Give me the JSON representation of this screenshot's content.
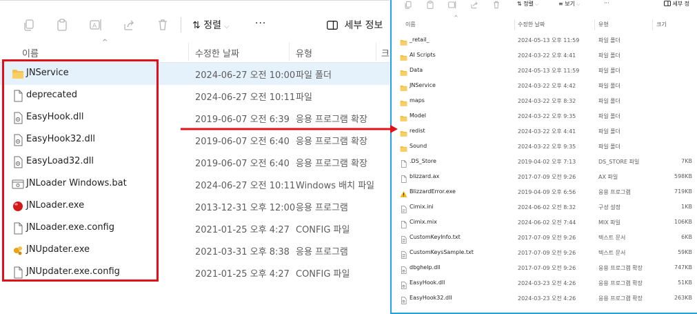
{
  "colors": {
    "highlight": "#e0101a",
    "accent": "#1fa2e8",
    "folder": "#f5c04a",
    "selection": "#e5f1fb"
  },
  "left": {
    "toolbar": {
      "icons": [
        "copy-icon",
        "paste-icon",
        "rename-icon",
        "share-icon",
        "delete-icon"
      ],
      "sort_label": "정렬",
      "more_label": "···",
      "details_label": "세부 정보"
    },
    "columns": {
      "name": "이름",
      "date": "수정한 날짜",
      "type": "유형",
      "size": "크"
    },
    "files": [
      {
        "name": "JNService",
        "date": "2024-06-27 오전 10:00",
        "type": "파일 폴더",
        "icon": "folder-icon"
      },
      {
        "name": "deprecated",
        "date": "2024-06-27 오전 10:11",
        "type": "파일",
        "icon": "file-icon"
      },
      {
        "name": "EasyHook.dll",
        "date": "2019-06-07 오전 6:39",
        "type": "응용 프로그램 확장",
        "icon": "dll-icon"
      },
      {
        "name": "EasyHook32.dll",
        "date": "2019-06-07 오전 6:40",
        "type": "응용 프로그램 확장",
        "icon": "dll-icon"
      },
      {
        "name": "EasyLoad32.dll",
        "date": "2019-06-07 오전 6:40",
        "type": "응용 프로그램 확장",
        "icon": "dll-icon"
      },
      {
        "name": "JNLoader Windows.bat",
        "date": "2024-06-27 오전 10:11",
        "type": "Windows 배치 파일",
        "icon": "bat-icon"
      },
      {
        "name": "JNLoader.exe",
        "date": "2013-12-31 오후 12:00",
        "type": "응용 프로그램",
        "icon": "red-ball-icon"
      },
      {
        "name": "JNLoader.exe.config",
        "date": "2021-01-25 오후 4:27",
        "type": "CONFIG 파일",
        "icon": "file-icon"
      },
      {
        "name": "JNUpdater.exe",
        "date": "2021-03-31 오후 8:38",
        "type": "응용 프로그램",
        "icon": "updater-icon"
      },
      {
        "name": "JNUpdater.exe.config",
        "date": "2021-01-25 오후 4:27",
        "type": "CONFIG 파일",
        "icon": "file-icon"
      }
    ]
  },
  "right": {
    "toolbar": {
      "icons": [
        "copy-icon",
        "paste-icon",
        "rename-icon",
        "share-icon",
        "delete-icon"
      ],
      "sort_label": "정렬",
      "view_label": "보기",
      "more_label": "···",
      "details_label": "세부 정"
    },
    "columns": {
      "name": "이름",
      "date": "수정한 날짜",
      "type": "유형",
      "size": "크기"
    },
    "files": [
      {
        "name": "_retail_",
        "date": "2024-05-13 오후 11:59",
        "type": "파일 폴더",
        "size": "",
        "icon": "folder-icon"
      },
      {
        "name": "AI Scripts",
        "date": "2024-03-22 오후 4:41",
        "type": "파일 폴더",
        "size": "",
        "icon": "folder-icon"
      },
      {
        "name": "Data",
        "date": "2024-05-13 오후 11:59",
        "type": "파일 폴더",
        "size": "",
        "icon": "folder-icon"
      },
      {
        "name": "JNService",
        "date": "2024-03-22 오후 4:42",
        "type": "파일 폴더",
        "size": "",
        "icon": "folder-icon"
      },
      {
        "name": "maps",
        "date": "2024-03-22 오후 8:32",
        "type": "파일 폴더",
        "size": "",
        "icon": "folder-icon"
      },
      {
        "name": "Model",
        "date": "2024-03-22 오후 9:35",
        "type": "파일 폴더",
        "size": "",
        "icon": "folder-icon"
      },
      {
        "name": "redist",
        "date": "2024-03-22 오후 4:41",
        "type": "파일 폴더",
        "size": "",
        "icon": "folder-icon"
      },
      {
        "name": "Sound",
        "date": "2024-03-22 오후 9:35",
        "type": "파일 폴더",
        "size": "",
        "icon": "folder-icon"
      },
      {
        "name": ".DS_Store",
        "date": "2019-04-02 오후 7:13",
        "type": "DS_STORE 파일",
        "size": "7KB",
        "icon": "file-icon"
      },
      {
        "name": "blizzard.ax",
        "date": "2017-07-09 오전 9:26",
        "type": "AX 파일",
        "size": "598KB",
        "icon": "file-icon"
      },
      {
        "name": "BlizzardError.exe",
        "date": "2019-04-09 오후 6:56",
        "type": "응용 프로그램",
        "size": "719KB",
        "icon": "warning-icon"
      },
      {
        "name": "Cimix.ini",
        "date": "2024-06-02 오전 8:32",
        "type": "구성 설정",
        "size": "1KB",
        "icon": "ini-icon"
      },
      {
        "name": "Cimix.mix",
        "date": "2024-06-02 오전 7:44",
        "type": "MIX 파일",
        "size": "106KB",
        "icon": "file-icon"
      },
      {
        "name": "CustomKeyInfo.txt",
        "date": "2017-07-09 오전 9:26",
        "type": "텍스트 문서",
        "size": "6KB",
        "icon": "txt-icon"
      },
      {
        "name": "CustomKeysSample.txt",
        "date": "2017-07-09 오전 9:26",
        "type": "텍스트 문서",
        "size": "59KB",
        "icon": "txt-icon"
      },
      {
        "name": "dbghelp.dll",
        "date": "2017-07-09 오전 9:26",
        "type": "응용 프로그램 확장",
        "size": "747KB",
        "icon": "dll-icon"
      },
      {
        "name": "EasyHook.dll",
        "date": "2024-03-23 오전 4:26",
        "type": "응용 프로그램 확장",
        "size": "51KB",
        "icon": "dll-icon"
      },
      {
        "name": "EasyHook32.dll",
        "date": "2024-03-23 오전 4:26",
        "type": "응용 프로그램 확장",
        "size": "263KB",
        "icon": "dll-icon"
      }
    ]
  }
}
